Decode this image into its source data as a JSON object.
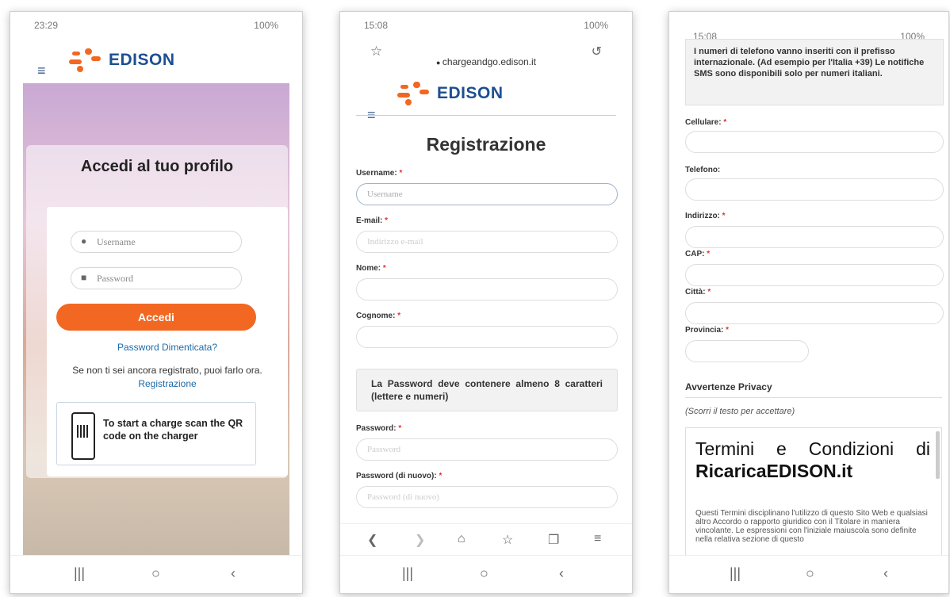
{
  "colors": {
    "accent": "#f26722",
    "brand": "#1d4f91",
    "link": "#1d6ba8"
  },
  "phone1": {
    "status_time": "23:29",
    "status_right": "100%",
    "logo": "EDISON",
    "title": "Accedi al tuo profilo",
    "username_placeholder": "Username",
    "password_placeholder": "Password",
    "login_button": "Accedi",
    "forgot": "Password Dimenticata?",
    "register_prompt": "Se non ti sei ancora registrato, puoi farlo ora.",
    "register_link": "Registrazione",
    "qr_text": "To start a charge scan the QR code on the charger"
  },
  "phone2": {
    "status_time": "15:08",
    "status_right": "100%",
    "url": "chargeandgo.edison.it",
    "logo": "EDISON",
    "title": "Registrazione",
    "fields": [
      {
        "label": "Username:",
        "placeholder": "Username"
      },
      {
        "label": "E-mail:",
        "placeholder": "Indirizzo e-mail"
      },
      {
        "label": "Nome:",
        "placeholder": ""
      },
      {
        "label": "Cognome:",
        "placeholder": ""
      }
    ],
    "password_note": "La Password deve contenere almeno 8 caratteri (lettere e numeri)",
    "password_fields": [
      {
        "label": "Password:",
        "placeholder": "Password"
      },
      {
        "label": "Password (di nuovo):",
        "placeholder": "Password (di nuovo)"
      }
    ]
  },
  "phone3": {
    "status_time": "15:08",
    "status_right": "100%",
    "info": "I numeri di telefono vanno inseriti con il prefisso internazionale. (Ad esempio per l'Italia +39) Le notifiche SMS sono disponibili solo per numeri italiani.",
    "fields": [
      {
        "label": "Cellulare:",
        "required": true
      },
      {
        "label": "Telefono:",
        "required": false
      },
      {
        "label": "Indirizzo:",
        "required": true
      },
      {
        "label": "CAP:",
        "required": true
      },
      {
        "label": "Città:",
        "required": true
      },
      {
        "label": "Provincia:",
        "required": true
      }
    ],
    "privacy_title": "Avvertenze Privacy",
    "privacy_hint": "(Scorri il testo per accettare)",
    "terms_heading": "Termini e Condizioni di",
    "terms_heading_bold": "RicaricaEDISON.it",
    "terms_body": "Questi Termini disciplinano l'utilizzo di questo Sito Web e qualsiasi altro Accordo o rapporto giuridico con il Titolare in maniera vincolante. Le espressioni con l'iniziale maiuscola sono definite nella relativa sezione di questo"
  },
  "required_mark": "*",
  "icons": [
    "menu-icon",
    "user-icon",
    "lock-icon",
    "star-icon",
    "reload-icon",
    "back-icon",
    "forward-icon",
    "home-icon",
    "tabs-icon",
    "overflow-menu-icon",
    "recents-icon",
    "home-circle-icon"
  ]
}
